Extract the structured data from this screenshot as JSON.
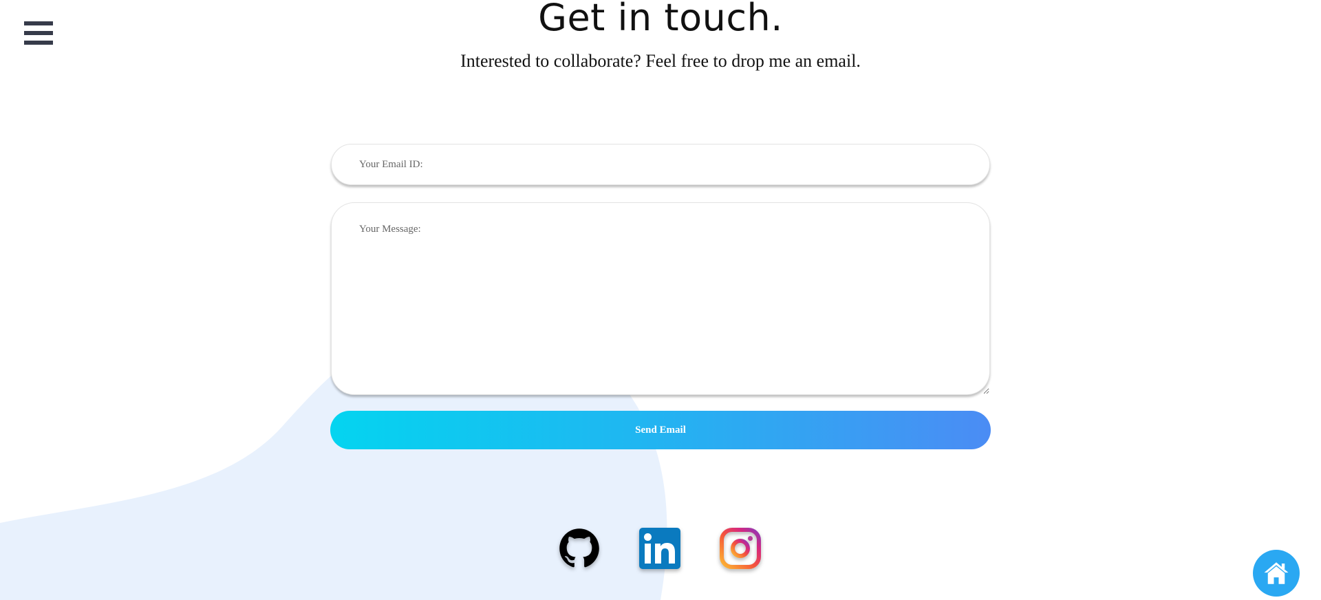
{
  "header": {
    "title": "Get in touch.",
    "subtitle": "Interested to collaborate? Feel free to drop me an email."
  },
  "form": {
    "email_placeholder": "Your Email ID:",
    "message_placeholder": "Your Message:",
    "send_label": "Send Email"
  },
  "social": {
    "items": [
      {
        "icon": "github-icon",
        "label": "GitHub"
      },
      {
        "icon": "linkedin-icon",
        "label": "LinkedIn"
      },
      {
        "icon": "instagram-icon",
        "label": "Instagram"
      }
    ]
  },
  "nav": {
    "menu_icon": "hamburger-menu-icon",
    "home_icon": "home-icon"
  },
  "colors": {
    "button_gradient_start": "#04d4f0",
    "button_gradient_end": "#4b8cf4",
    "background_blob": "#e8f1fd",
    "menu_icon": "#363b4a",
    "home_button": "#2aa8f2"
  }
}
